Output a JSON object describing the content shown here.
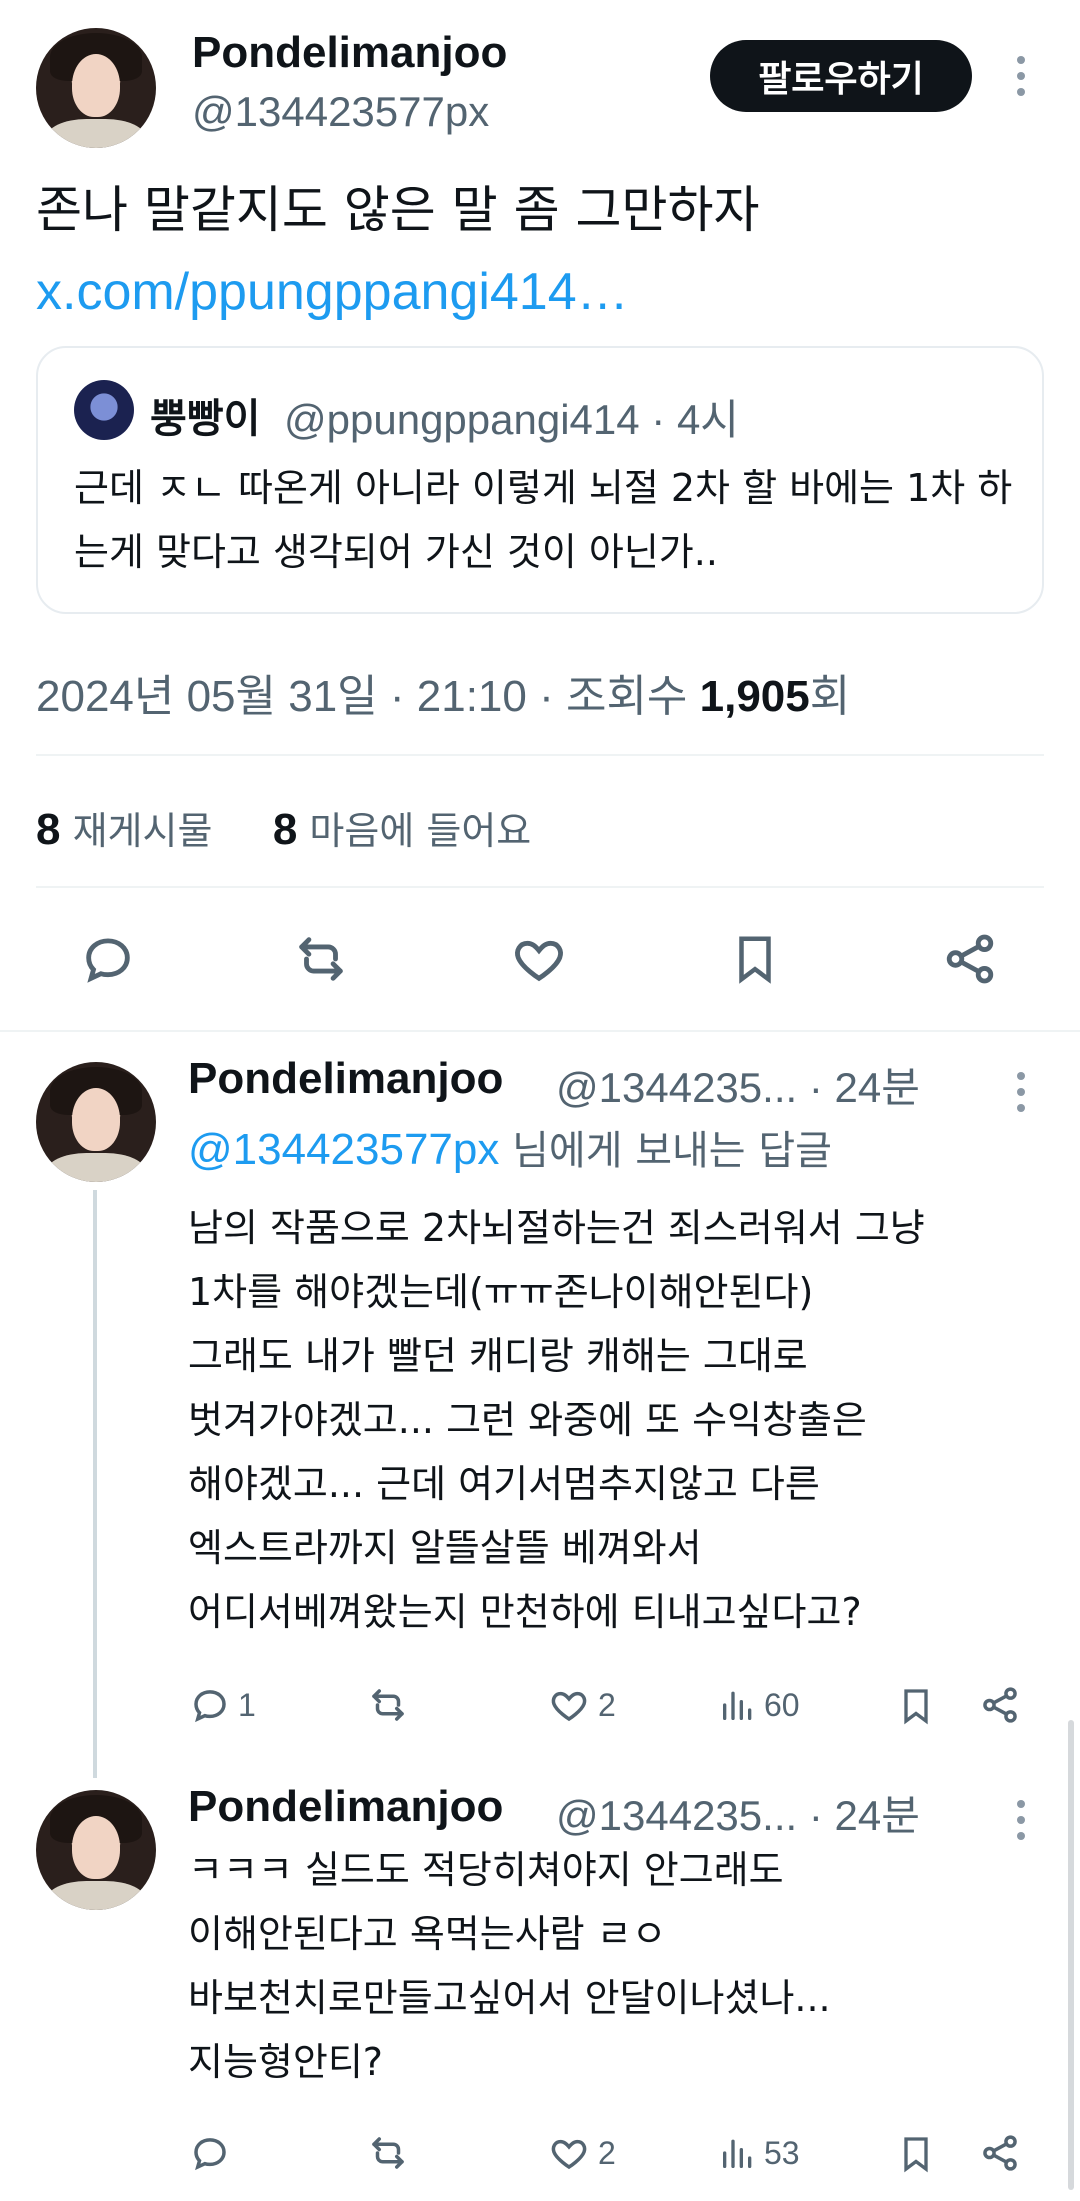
{
  "main_tweet": {
    "name": "Pondelimanjoo",
    "handle": "@134423577px",
    "follow_label": "팔로우하기",
    "text": "존나 말같지도 않은 말 좀 그만하자",
    "link": "x.com/ppungppangi414…",
    "quote": {
      "name": "뿡빵이",
      "handle_time": "@ppungppangi414 · 4시",
      "text": "근데 ㅈㄴ 따온게 아니라 이렇게 뇌절 2차 할 바에는 1차 하는게 맞다고 생각되어 가신 것이 아닌가.."
    },
    "meta_prefix": "2024년 05월 31일 · 21:10 · 조회수 ",
    "views": "1,905",
    "views_suffix": "회",
    "reposts_count": "8",
    "reposts_label": "재게시물",
    "likes_count": "8",
    "likes_label": "마음에 들어요"
  },
  "replies": [
    {
      "name": "Pondelimanjoo",
      "handle_time": "@1344235... · 24분",
      "replying_mention": "@134423577px",
      "replying_suffix": " 님에게 보내는 답글",
      "lines": [
        "남의 작품으로 2차뇌절하는건 죄스러워서 그냥",
        "1차를 해야겠는데(ㅠㅠ존나이해안된다)",
        "그래도 내가 빨던 캐디랑 캐해는 그대로",
        "벗겨가야겠고... 그런 와중에 또 수익창출은",
        "해야겠고... 근데 여기서멈추지않고 다른",
        "엑스트라까지 알뜰살뜰 베껴와서",
        "어디서베껴왔는지 만천하에 티내고싶다고?"
      ],
      "reply_count": "1",
      "like_count": "2",
      "view_count": "60"
    },
    {
      "name": "Pondelimanjoo",
      "handle_time": "@1344235... · 24분",
      "lines": [
        "ㅋㅋㅋ 실드도 적당히쳐야지 안그래도",
        "이해안된다고 욕먹는사람 ㄹㅇ",
        "바보천치로만들고싶어서 안달이나셨나...",
        "지능형안티?"
      ],
      "reply_count": "",
      "like_count": "2",
      "view_count": "53"
    }
  ],
  "icons": [
    "reply-icon",
    "repost-icon",
    "like-icon",
    "bookmark-icon",
    "share-icon",
    "views-icon",
    "more-icon"
  ]
}
